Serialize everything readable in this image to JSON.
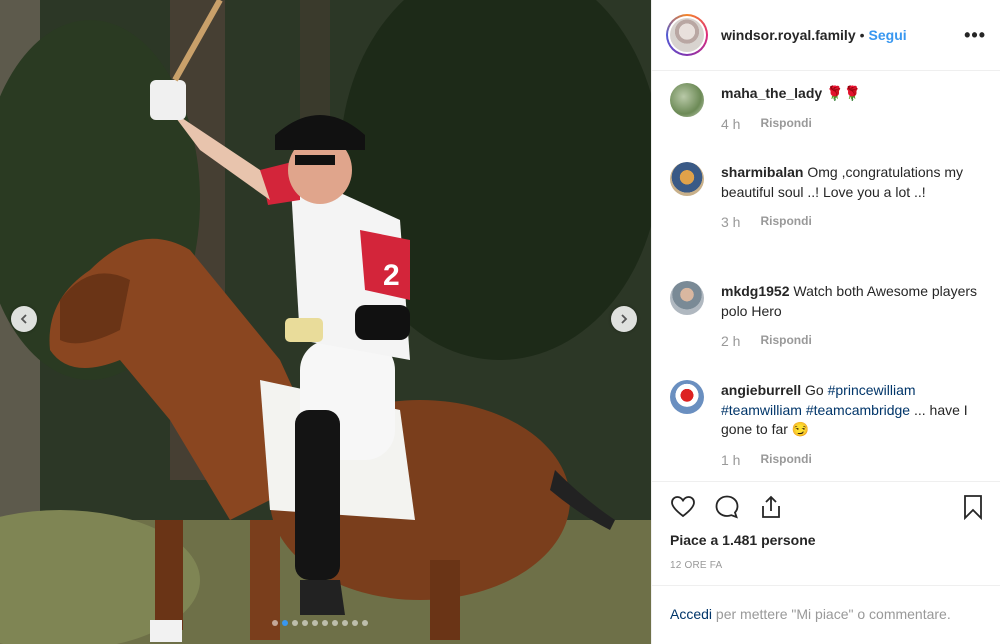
{
  "post": {
    "username": "windsor.royal.family",
    "separator": "•",
    "follow_label": "Segui",
    "more_label": "•••",
    "carousel_count": 10,
    "carousel_active_index": 1
  },
  "comments": [
    {
      "username": "maha_the_lady",
      "text": " 🌹🌹",
      "time": "4 h",
      "reply_label": "Rispondi"
    },
    {
      "username": "sharmibalan",
      "text": " Omg ,congratulations my beautiful soul ..! Love you a lot ..!",
      "time": "3 h",
      "reply_label": "Rispondi"
    },
    {
      "username": "mkdg1952",
      "text": " Watch both Awesome players polo Hero",
      "time": "2 h",
      "reply_label": "Rispondi"
    },
    {
      "username": "angieburrell",
      "text_before": " Go ",
      "tag1": "#princewilliam",
      "tag2": "#teamwilliam",
      "tag3": "#teamcambridge",
      "text_after": " ... have I gone to far 😏",
      "time": "1 h",
      "reply_label": "Rispondi"
    }
  ],
  "actions": {
    "likes_text": "Piace a 1.481 persone",
    "time_ago": "12 ORE FA"
  },
  "login": {
    "link_label": "Accedi",
    "rest_text": " per mettere \"Mi piace\" o commentare."
  },
  "colors": {
    "accent": "#3897f0",
    "link": "#003569",
    "muted": "#999999"
  },
  "icons": [
    "heart-icon",
    "comment-icon",
    "share-icon",
    "bookmark-icon",
    "chevron-left-icon",
    "chevron-right-icon"
  ]
}
